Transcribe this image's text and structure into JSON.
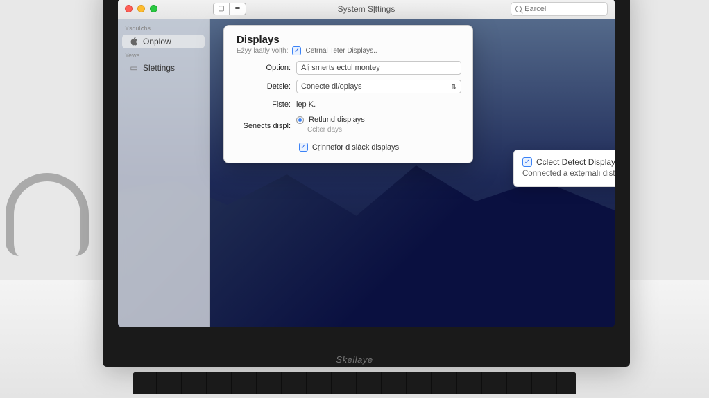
{
  "titlebar": {
    "title": "System Sḷttings",
    "search_placeholder": "Ẹarcel"
  },
  "sidebar": {
    "sections": [
      {
        "label": "Ysdulⅽhs",
        "items": [
          {
            "icon": "apple",
            "label": "Onplow",
            "selected": true
          }
        ]
      },
      {
        "label": "Yews",
        "items": [
          {
            "icon": "folder",
            "label": "Slettings",
            "selected": false
          }
        ]
      }
    ]
  },
  "panel": {
    "title": "Displays",
    "subrow": {
      "label": "Eżyy laatly volṭh:",
      "checkbox_label": "Cetrnal Teter Displays.."
    },
    "rows": {
      "option": {
        "label": "Option:",
        "value": "Alị smerts ectul montey"
      },
      "detsic": {
        "label": "Detsie:",
        "value": "Conecte dl/oplays"
      },
      "fiste": {
        "label": "Fiste:",
        "value": "lep K."
      },
      "senects": {
        "label": "Senects displ:",
        "radio1": "Retlund displays",
        "radio2": "Cclter days"
      }
    },
    "bottom_check": "Cṛinnefor d slàck displays"
  },
  "callout": {
    "title": "Cclect Detect Displays:",
    "body": "Connected a extẹrnalı distways."
  },
  "laptop_brand": "Skellaye"
}
